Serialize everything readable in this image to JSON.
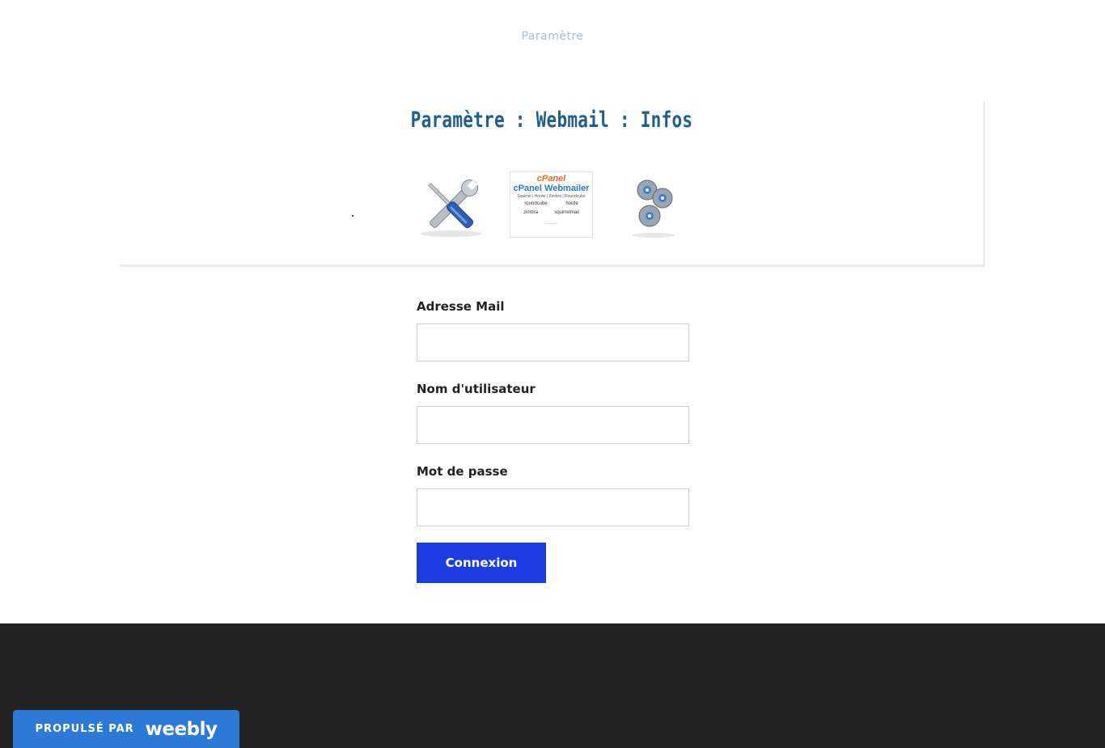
{
  "nav": {
    "link": "Paramètre"
  },
  "banner": {
    "title": "Paramètre : Webmail : Infos",
    "cpanel": {
      "brand": "cPanel",
      "title": "cPanel Webmailer",
      "subtitle": "Squirrel | Horde | Zimbra | Roundcube",
      "logos": [
        "roundcube",
        "horde",
        "zimbra",
        "squirrelmail"
      ]
    }
  },
  "form": {
    "email_label": "Adresse Mail",
    "username_label": "Nom d'utilisateur",
    "password_label": "Mot de passe",
    "submit_label": "Connexion"
  },
  "footer": {
    "badge_text": "PROPULSÉ PAR",
    "badge_logo": "weebly"
  },
  "colors": {
    "accent": "#1b3de0",
    "title": "#1f5f8b",
    "footer": "#232323",
    "badge": "#2d7ad6"
  }
}
